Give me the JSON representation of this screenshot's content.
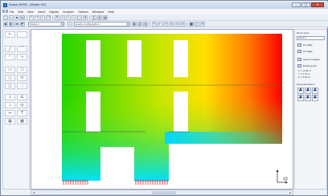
{
  "window": {
    "title": "Dlubal RFEM - [Model.rf5]",
    "buttons": {
      "minimize": "_",
      "maximize": "□",
      "close": "✕"
    }
  },
  "menu": {
    "items": [
      "File",
      "Edit",
      "View",
      "Insert",
      "Display",
      "Analysis",
      "Options",
      "Windows",
      "Help"
    ]
  },
  "toolbar": {
    "model_select": "Model 1",
    "configuration_select": "Loads configuration"
  },
  "right_panel": {
    "heading": "Work area",
    "layer_select": "Level 1",
    "buttons": [
      "0-1 New",
      "0-1 New",
      "Level manager",
      "Drawing aid"
    ],
    "readouts": [
      "X = -0.00 m",
      "Y = 2.70 m",
      "Z = 0.00 m"
    ],
    "representation_heading": "Representation"
  },
  "colors": {
    "gradient_left": "#22d400",
    "gradient_mid": "#ffe000",
    "gradient_right": "#ff0000",
    "gradient_bottom": "#00e0ff",
    "support": "#d12020"
  },
  "icons": {
    "palette": [
      "select-arrow-icon",
      "node-icon",
      "line-icon",
      "arc-icon",
      "rectangle-icon",
      "polygon-icon",
      "circle-icon",
      "opening-icon",
      "load-icon",
      "support-icon",
      "hinge-icon",
      "dimension-icon"
    ]
  }
}
